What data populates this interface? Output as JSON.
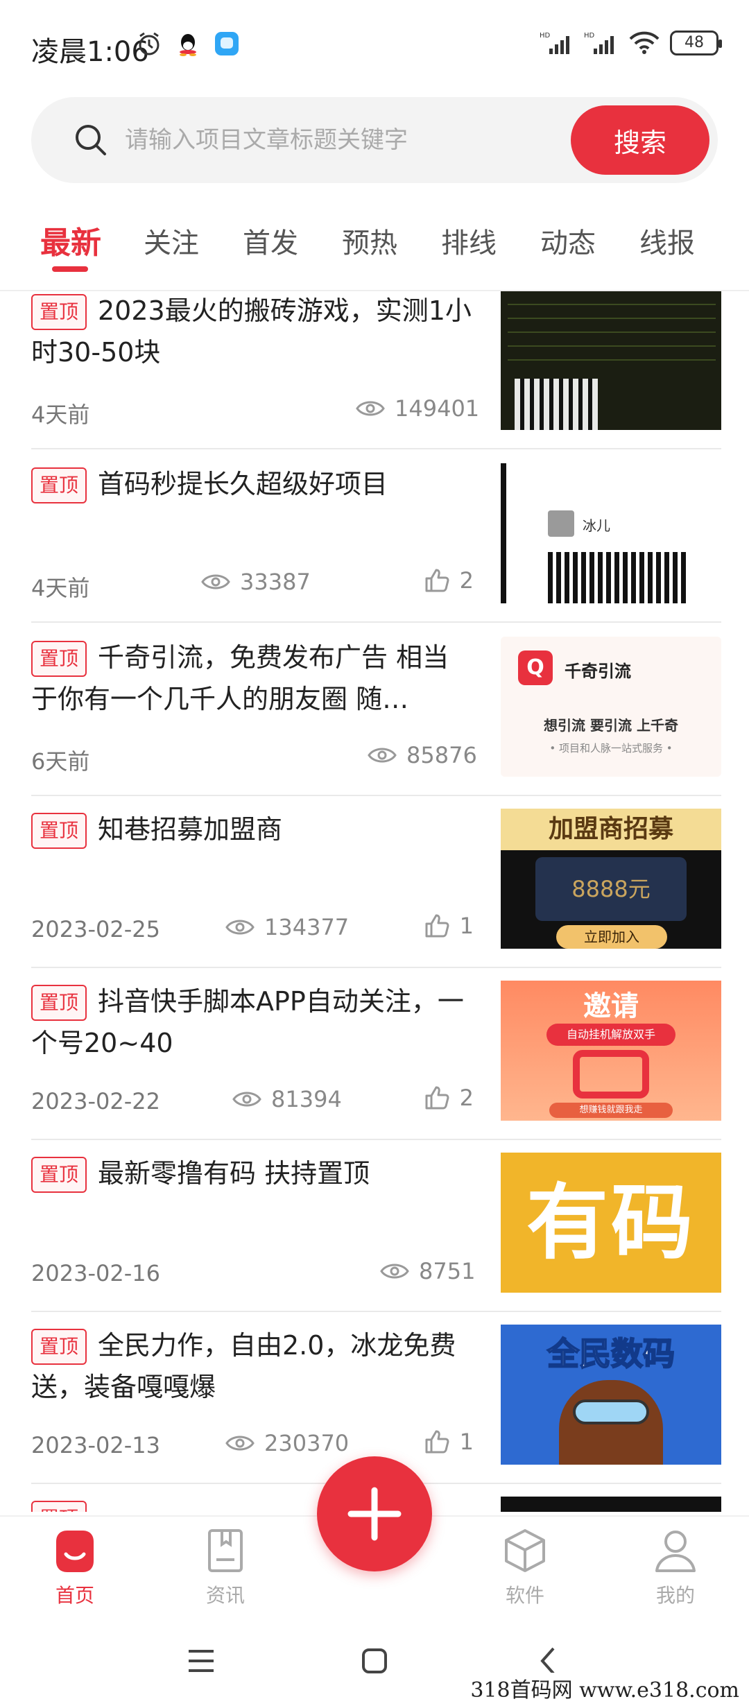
{
  "status_bar": {
    "time": "凌晨1:06",
    "battery": "48"
  },
  "search": {
    "placeholder": "请输入项目文章标题关键字",
    "button_label": "搜索"
  },
  "tabs": [
    {
      "label": "最新",
      "active": true
    },
    {
      "label": "关注",
      "active": false
    },
    {
      "label": "首发",
      "active": false
    },
    {
      "label": "预热",
      "active": false
    },
    {
      "label": "排线",
      "active": false
    },
    {
      "label": "动态",
      "active": false
    },
    {
      "label": "线报",
      "active": false
    }
  ],
  "pin_label": "置顶",
  "articles": [
    {
      "title": "2023最火的搬砖游戏，实测1小时30-50块",
      "date": "4天前",
      "views": "149401",
      "likes": ""
    },
    {
      "title": "首码秒提长久超级好项目",
      "date": "4天前",
      "views": "33387",
      "likes": "2",
      "thumb_name": "冰儿"
    },
    {
      "title": "千奇引流，免费发布广告 相当于你有一个几千人的朋友圈 随…",
      "date": "6天前",
      "views": "85876",
      "likes": "",
      "thumb_title": "千奇引流",
      "thumb_slogan": "想引流 要引流 上千奇",
      "thumb_sub": "• 项目和人脉一站式服务 •"
    },
    {
      "title": "知巷招募加盟商",
      "date": "2023-02-25",
      "views": "134377",
      "likes": "1",
      "thumb_head": "加盟商招募",
      "thumb_amount": "8888元",
      "thumb_btn": "立即加入"
    },
    {
      "title": "抖音快手脚本APP自动关注，一个号20~40",
      "date": "2023-02-22",
      "views": "81394",
      "likes": "2",
      "thumb_title": "邀请",
      "thumb_badge": "自动挂机解放双手",
      "thumb_foot": "想赚钱就跟我走"
    },
    {
      "title": "最新零撸有码 扶持置顶",
      "date": "2023-02-16",
      "views": "8751",
      "likes": "",
      "thumb_text": "有码"
    },
    {
      "title": "全民力作，自由2.0，冰龙免费送，装备嘎嘎爆",
      "date": "2023-02-13",
      "views": "230370",
      "likes": "1",
      "thumb_title": "全民数码"
    }
  ],
  "bottom_nav": [
    {
      "label": "首页",
      "icon": "home-icon",
      "active": true
    },
    {
      "label": "资讯",
      "icon": "news-icon",
      "active": false
    },
    {
      "label": "软件",
      "icon": "cube-icon",
      "active": false
    },
    {
      "label": "我的",
      "icon": "person-icon",
      "active": false
    }
  ],
  "watermark": "318首码网  www.e318.com",
  "colors": {
    "accent": "#e8313e",
    "muted": "#888888"
  }
}
